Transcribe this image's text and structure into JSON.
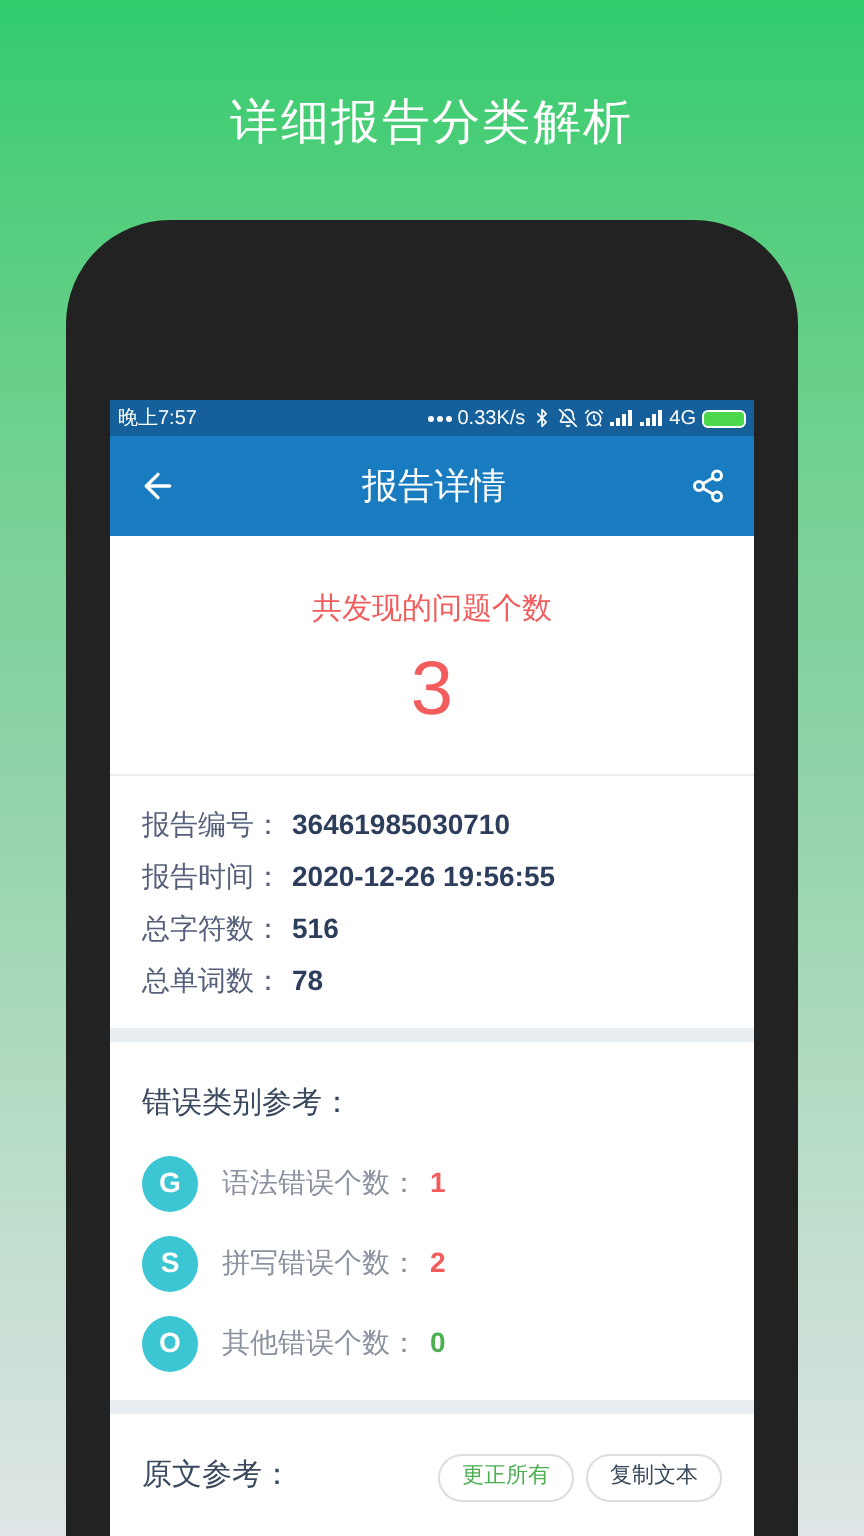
{
  "headline": "详细报告分类解析",
  "status_bar": {
    "time": "晚上7:57",
    "speed": "0.33K/s",
    "network": "4G"
  },
  "app_bar": {
    "title": "报告详情"
  },
  "summary": {
    "label": "共发现的问题个数",
    "count": "3"
  },
  "info": [
    {
      "label": "报告编号：",
      "value": "36461985030710"
    },
    {
      "label": "报告时间：",
      "value": "2020-12-26 19:56:55"
    },
    {
      "label": "总字符数：",
      "value": "516"
    },
    {
      "label": "总单词数：",
      "value": "78"
    }
  ],
  "categories": {
    "title": "错误类别参考：",
    "items": [
      {
        "letter": "G",
        "label": "语法错误个数：",
        "count": "1",
        "color": "#f25c5c"
      },
      {
        "letter": "S",
        "label": "拼写错误个数：",
        "count": "2",
        "color": "#f25c5c"
      },
      {
        "letter": "O",
        "label": "其他错误个数：",
        "count": "0",
        "color": "#4caf50"
      }
    ]
  },
  "original": {
    "title": "原文参考：",
    "buttons": [
      {
        "label": "更正所有",
        "kind": "accent"
      },
      {
        "label": "复制文本",
        "kind": "plain"
      }
    ]
  }
}
